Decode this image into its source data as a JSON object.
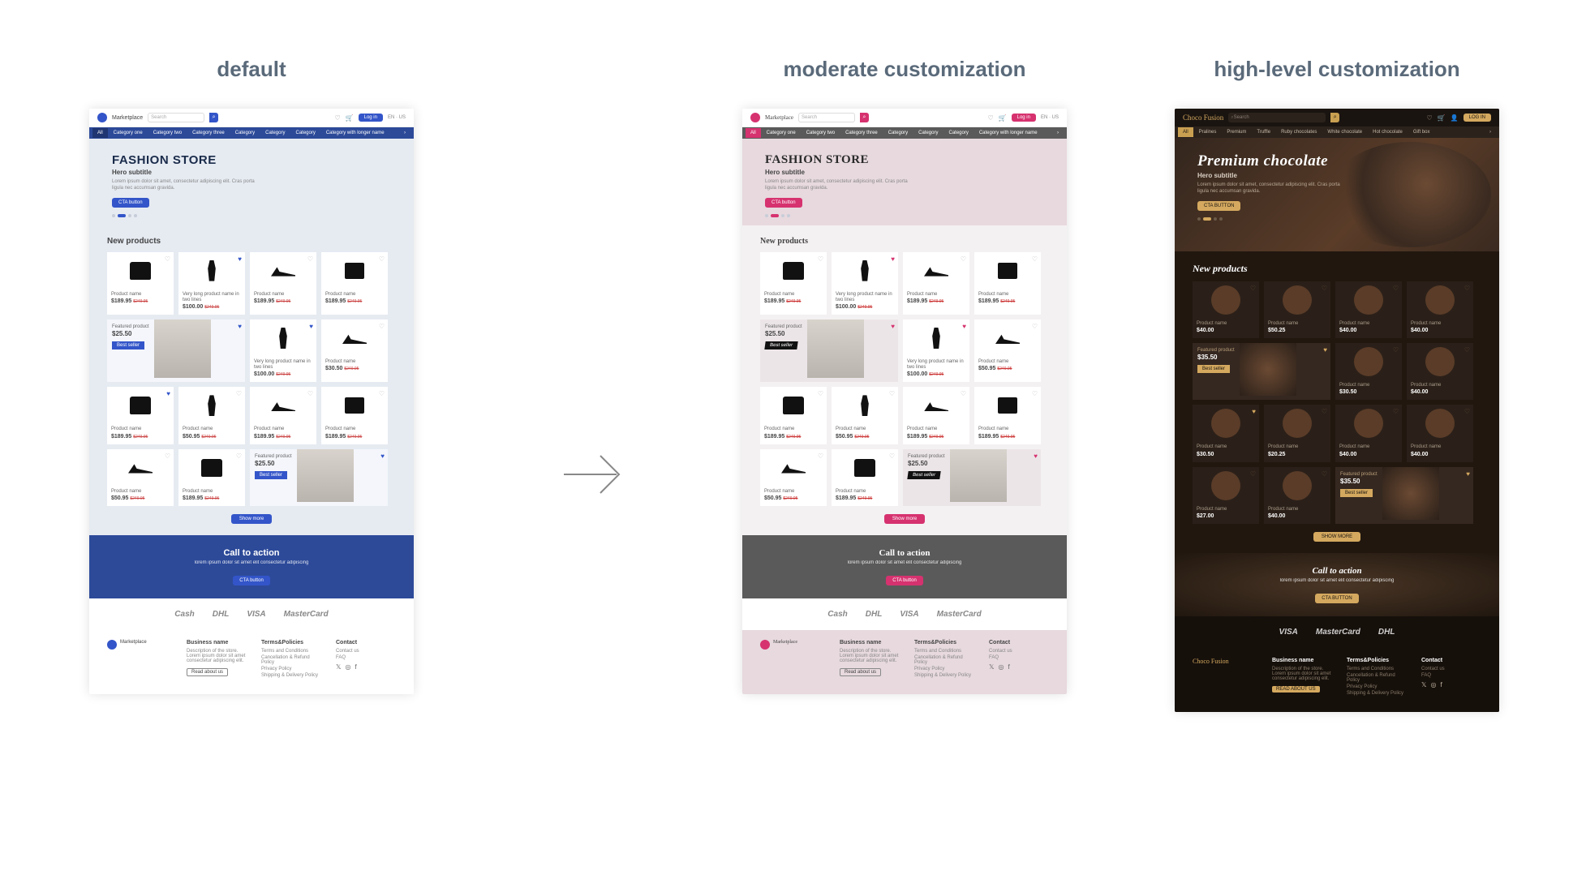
{
  "labels": {
    "default": "default",
    "moderate": "moderate customization",
    "high": "high-level customization"
  },
  "common": {
    "brand_marketplace": "Marketplace",
    "search_ph": "Search",
    "login": "Log in",
    "lang": "EN · US",
    "nav": {
      "all": "All",
      "items": [
        "Category one",
        "Category two",
        "Category three",
        "Category",
        "Category",
        "Category",
        "Category with longer name"
      ]
    },
    "hero_fashion": {
      "title": "FASHION STORE",
      "subtitle": "Hero subtitle",
      "lorem": "Lorem ipsum dolor sit amet, consectetur adipiscing elit. Cras porta ligula nec accumsan gravida.",
      "cta": "CTA button"
    },
    "new_products": "New products",
    "card": {
      "name": "Product name",
      "long": "Very long product name in two lines",
      "feat": "Featured product",
      "p189": "$189.95",
      "p100": "$100.00",
      "p50": "$50.95",
      "p30": "$30.50",
      "p25": "$25.50",
      "old": "$249.95",
      "badge": "Best seller"
    },
    "show_more": "Show more",
    "c2a": {
      "title": "Call to action",
      "sub": "lorem ipsum dolor sit amet elit consectetur adipiscing",
      "btn": "CTA button"
    },
    "pay": {
      "cash": "Cash",
      "dhl": "DHL",
      "visa": "VISA",
      "mc": "MasterCard"
    },
    "footer": {
      "biz": {
        "h": "Business name",
        "d1": "Description of the store. Lorem ipsum dolor sit amet consectetur adipiscing elit.",
        "btn": "Read about us"
      },
      "terms": {
        "h": "Terms&Policies",
        "i": [
          "Terms and Conditions",
          "Cancellation & Refund Policy",
          "Privacy Policy",
          "Shipping & Delivery Policy"
        ]
      },
      "contact": {
        "h": "Contact",
        "i": [
          "Contact us",
          "FAQ"
        ]
      }
    }
  },
  "hi": {
    "brand": "Choco Fusion",
    "search_ph": "Search",
    "login": "LOG IN",
    "nav": {
      "all": "All",
      "items": [
        "Pralines",
        "Premium",
        "Truffle",
        "Ruby chocolates",
        "White chocolate",
        "Hot chocolate",
        "Gift box"
      ]
    },
    "hero": {
      "title": "Premium chocolate",
      "subtitle": "Hero subtitle",
      "lorem": "Lorem ipsum dolor sit amet, consectetur adipiscing elit. Cras porta ligula nec accumsan gravida.",
      "cta": "CTA BUTTON"
    },
    "new_products": "New products",
    "prices": {
      "p40": "$40.00",
      "p50": "$50.25",
      "p35": "$35.50",
      "p20": "$20.25",
      "p30": "$30.50",
      "p27": "$27.00"
    },
    "show_more": "SHOW MORE",
    "footer_btn": "READ ABOUT US"
  }
}
